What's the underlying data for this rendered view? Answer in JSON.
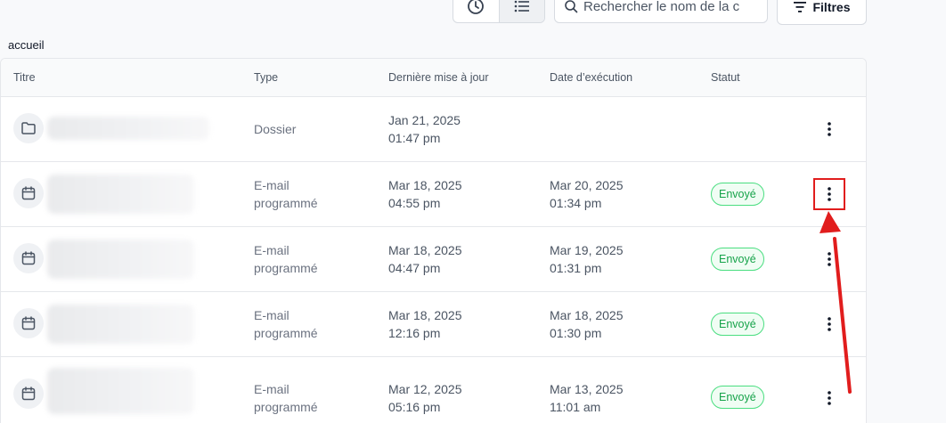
{
  "toolbar": {
    "search_placeholder": "Rechercher le nom de la c",
    "filters_label": "Filtres"
  },
  "breadcrumb": "accueil",
  "table": {
    "headers": {
      "title": "Titre",
      "type": "Type",
      "updated": "Dernière mise à jour",
      "executed": "Date d’exécution",
      "status": "Statut"
    },
    "rows": [
      {
        "icon": "folder-icon",
        "type_l1": "Dossier",
        "type_l2": "",
        "updated_l1": "Jan 21, 2025",
        "updated_l2": "01:47 pm",
        "executed_l1": "",
        "executed_l2": "",
        "status": ""
      },
      {
        "icon": "calendar-icon",
        "type_l1": "E-mail",
        "type_l2": "programmé",
        "updated_l1": "Mar 18, 2025",
        "updated_l2": "04:55 pm",
        "executed_l1": "Mar 20, 2025",
        "executed_l2": "01:34 pm",
        "status": "Envoyé"
      },
      {
        "icon": "calendar-icon",
        "type_l1": "E-mail",
        "type_l2": "programmé",
        "updated_l1": "Mar 18, 2025",
        "updated_l2": "04:47 pm",
        "executed_l1": "Mar 19, 2025",
        "executed_l2": "01:31 pm",
        "status": "Envoyé"
      },
      {
        "icon": "calendar-icon",
        "type_l1": "E-mail",
        "type_l2": "programmé",
        "updated_l1": "Mar 18, 2025",
        "updated_l2": "12:16 pm",
        "executed_l1": "Mar 18, 2025",
        "executed_l2": "01:30 pm",
        "status": "Envoyé"
      },
      {
        "icon": "calendar-icon",
        "type_l1": "E-mail",
        "type_l2": "programmé",
        "updated_l1": "Mar 12, 2025",
        "updated_l2": "05:16 pm",
        "executed_l1": "Mar 13, 2025",
        "executed_l2": "11:01 am",
        "status": "Envoyé"
      }
    ]
  },
  "colors": {
    "status_green": "#16a34a",
    "annotation_red": "#e11d1d"
  }
}
